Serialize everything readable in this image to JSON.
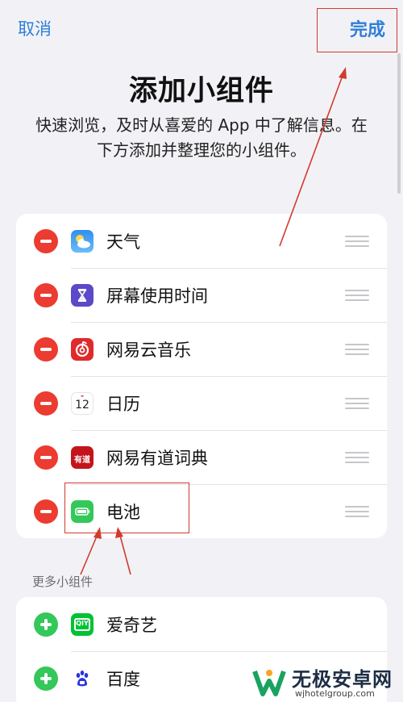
{
  "nav": {
    "cancel": "取消",
    "done": "完成"
  },
  "header": {
    "title": "添加小组件",
    "description": "快速浏览，及时从喜爱的 App 中了解信息。在下方添加并整理您的小组件。"
  },
  "active_widgets": [
    {
      "label": "天气",
      "icon": "weather-icon"
    },
    {
      "label": "屏幕使用时间",
      "icon": "hourglass-icon"
    },
    {
      "label": "网易云音乐",
      "icon": "netease-music-icon"
    },
    {
      "label": "日历",
      "icon": "calendar-icon",
      "icon_text": "12"
    },
    {
      "label": "网易有道词典",
      "icon": "youdao-icon",
      "icon_text": "有道"
    },
    {
      "label": "电池",
      "icon": "battery-icon"
    }
  ],
  "more_widgets": {
    "header": "更多小组件",
    "items": [
      {
        "label": "爱奇艺",
        "icon": "iqiyi-icon",
        "icon_text": "QIY"
      },
      {
        "label": "百度",
        "icon": "baidu-icon"
      }
    ]
  },
  "watermark": {
    "title": "无极安卓网",
    "url": "wjhotelgroup.com"
  },
  "colors": {
    "accent": "#2f7fd8",
    "remove": "#ec3b30",
    "add": "#34c759",
    "highlight": "#d23a2e"
  }
}
